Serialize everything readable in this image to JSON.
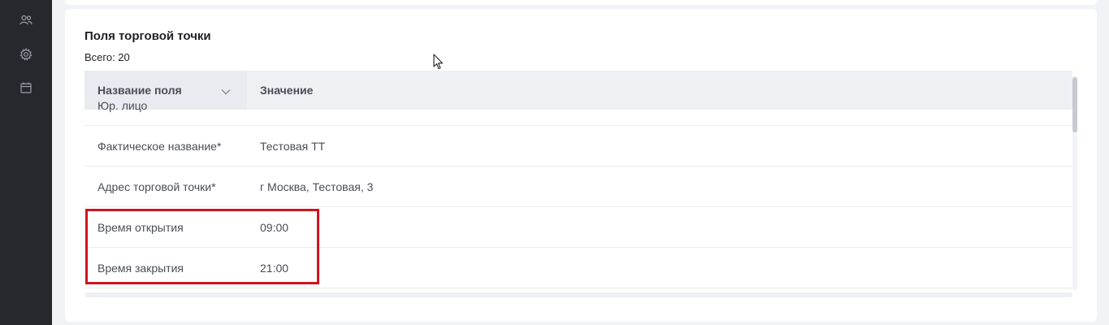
{
  "sidebar": {
    "icons": [
      "users-icon",
      "gear-icon",
      "calendar-icon"
    ]
  },
  "section": {
    "title": "Поля торговой точки",
    "total": "Всего: 20"
  },
  "table": {
    "columns": [
      "Название поля",
      "Значение"
    ],
    "partial_row": {
      "name": "Юр. лицо",
      "value": ""
    },
    "rows": [
      {
        "name": "Фактическое название*",
        "value": "Тестовая ТТ"
      },
      {
        "name": "Адрес торговой точки*",
        "value": "г Москва, Тестовая, 3"
      },
      {
        "name": "Время открытия",
        "value": "09:00"
      },
      {
        "name": "Время закрытия",
        "value": "21:00"
      }
    ]
  },
  "colors": {
    "sidebar_bg": "#26282d",
    "highlight": "#d0131f",
    "header_bg": "#eff0f4"
  }
}
